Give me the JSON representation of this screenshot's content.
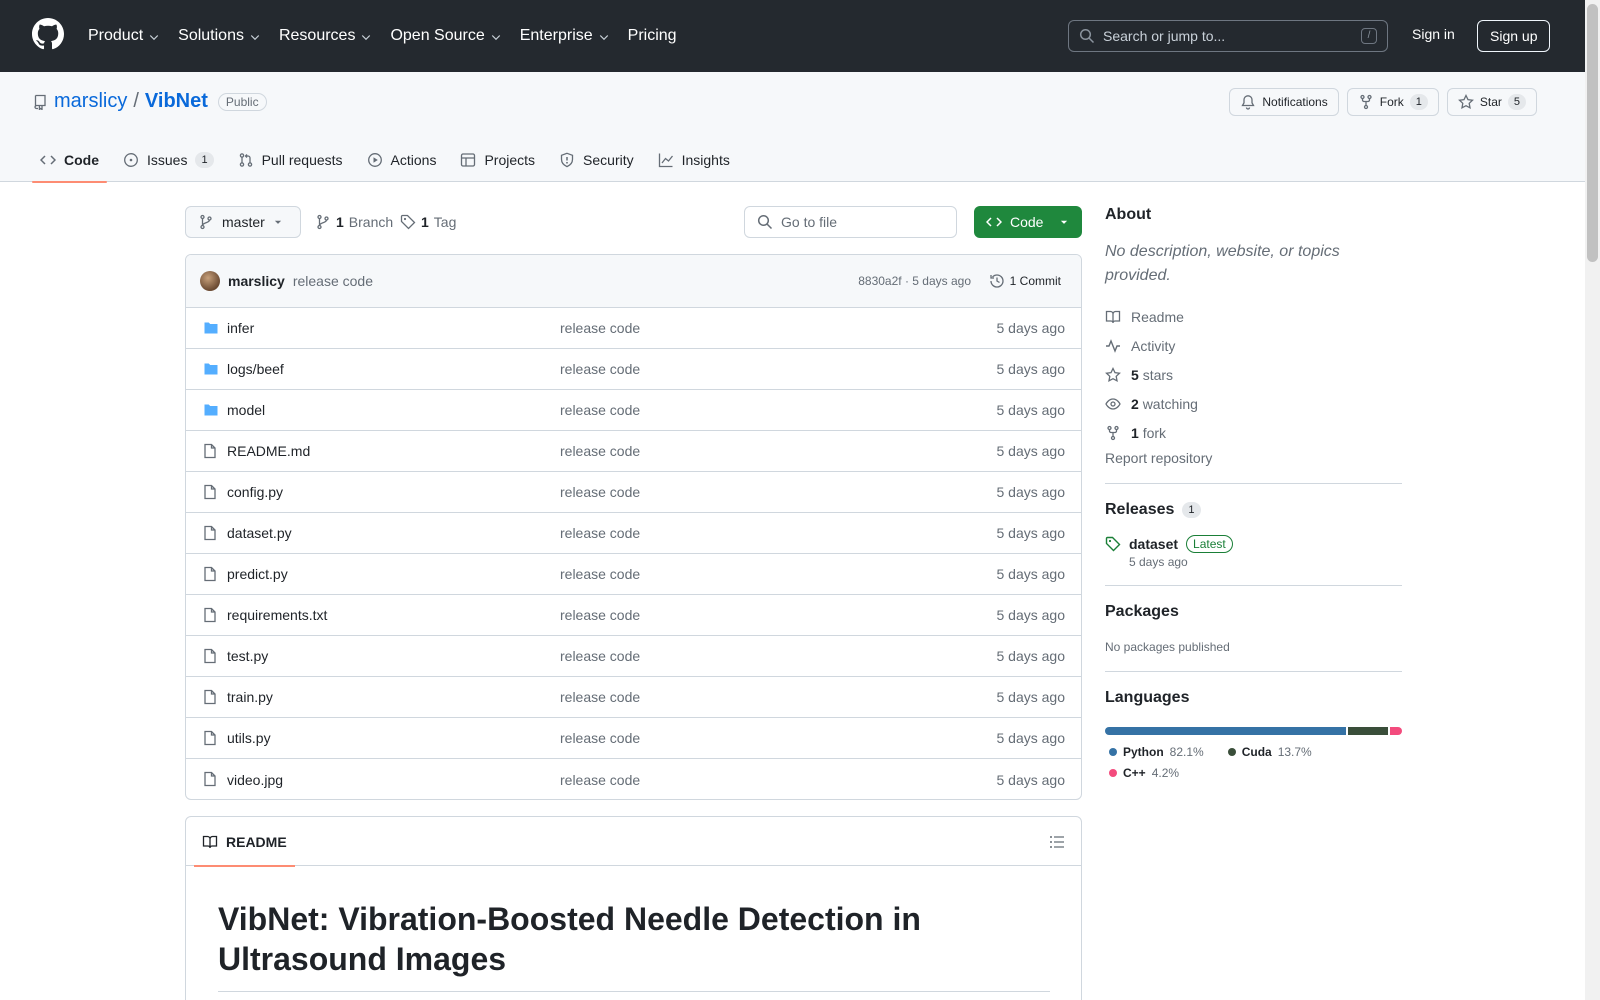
{
  "header": {
    "nav": [
      "Product",
      "Solutions",
      "Resources",
      "Open Source",
      "Enterprise"
    ],
    "pricing": "Pricing",
    "search_placeholder": "Search or jump to...",
    "search_key": "/",
    "sign_in": "Sign in",
    "sign_up": "Sign up"
  },
  "repo": {
    "owner": "marslicy",
    "sep": "/",
    "name": "VibNet",
    "visibility": "Public",
    "notifications": "Notifications",
    "fork_label": "Fork",
    "fork_count": "1",
    "star_label": "Star",
    "star_count": "5"
  },
  "tabs": [
    {
      "label": "Code",
      "icon": "code-icon"
    },
    {
      "label": "Issues",
      "count": "1",
      "icon": "issue-icon"
    },
    {
      "label": "Pull requests",
      "icon": "pull-request-icon"
    },
    {
      "label": "Actions",
      "icon": "play-icon"
    },
    {
      "label": "Projects",
      "icon": "table-icon"
    },
    {
      "label": "Security",
      "icon": "shield-icon"
    },
    {
      "label": "Insights",
      "icon": "graph-icon"
    }
  ],
  "toolbar": {
    "branch": "master",
    "branch_count": "1",
    "branch_label": "Branch",
    "tag_count": "1",
    "tag_label": "Tag",
    "goto_placeholder": "Go to file",
    "code_button": "Code"
  },
  "commit": {
    "author": "marslicy",
    "message": "release code",
    "meta": "8830a2f · 5 days ago",
    "count_label": "1 Commit"
  },
  "files": [
    {
      "name": "infer",
      "type": "dir",
      "message": "release code",
      "age": "5 days ago"
    },
    {
      "name": "logs/beef",
      "type": "dir",
      "message": "release code",
      "age": "5 days ago"
    },
    {
      "name": "model",
      "type": "dir",
      "message": "release code",
      "age": "5 days ago"
    },
    {
      "name": "README.md",
      "type": "file",
      "message": "release code",
      "age": "5 days ago"
    },
    {
      "name": "config.py",
      "type": "file",
      "message": "release code",
      "age": "5 days ago"
    },
    {
      "name": "dataset.py",
      "type": "file",
      "message": "release code",
      "age": "5 days ago"
    },
    {
      "name": "predict.py",
      "type": "file",
      "message": "release code",
      "age": "5 days ago"
    },
    {
      "name": "requirements.txt",
      "type": "file",
      "message": "release code",
      "age": "5 days ago"
    },
    {
      "name": "test.py",
      "type": "file",
      "message": "release code",
      "age": "5 days ago"
    },
    {
      "name": "train.py",
      "type": "file",
      "message": "release code",
      "age": "5 days ago"
    },
    {
      "name": "utils.py",
      "type": "file",
      "message": "release code",
      "age": "5 days ago"
    },
    {
      "name": "video.jpg",
      "type": "file",
      "message": "release code",
      "age": "5 days ago"
    }
  ],
  "readme": {
    "tab": "README",
    "title": "VibNet: Vibration-Boosted Needle Detection in Ultrasound Images"
  },
  "about": {
    "heading": "About",
    "description": "No description, website, or topics provided.",
    "readme": "Readme",
    "activity": "Activity",
    "stars_count": "5",
    "stars_label": "stars",
    "watching_count": "2",
    "watching_label": "watching",
    "fork_count": "1",
    "fork_label": "fork",
    "report": "Report repository"
  },
  "releases": {
    "heading": "Releases",
    "count": "1",
    "name": "dataset",
    "badge": "Latest",
    "date": "5 days ago"
  },
  "packages": {
    "heading": "Packages",
    "text": "No packages published"
  },
  "languages": {
    "heading": "Languages",
    "items": [
      {
        "name": "Python",
        "percent": "82.1%",
        "value": 82.1,
        "color": "#3572A5"
      },
      {
        "name": "Cuda",
        "percent": "13.7%",
        "value": 13.7,
        "color": "#3A4E3A"
      },
      {
        "name": "C++",
        "percent": "4.2%",
        "value": 4.2,
        "color": "#f34b7d"
      }
    ]
  },
  "colors": {
    "header_bg": "#24292f",
    "link": "#0969da",
    "primary_button": "#1f883d",
    "tab_underline": "#fd8c73",
    "folder": "#54aeff"
  }
}
